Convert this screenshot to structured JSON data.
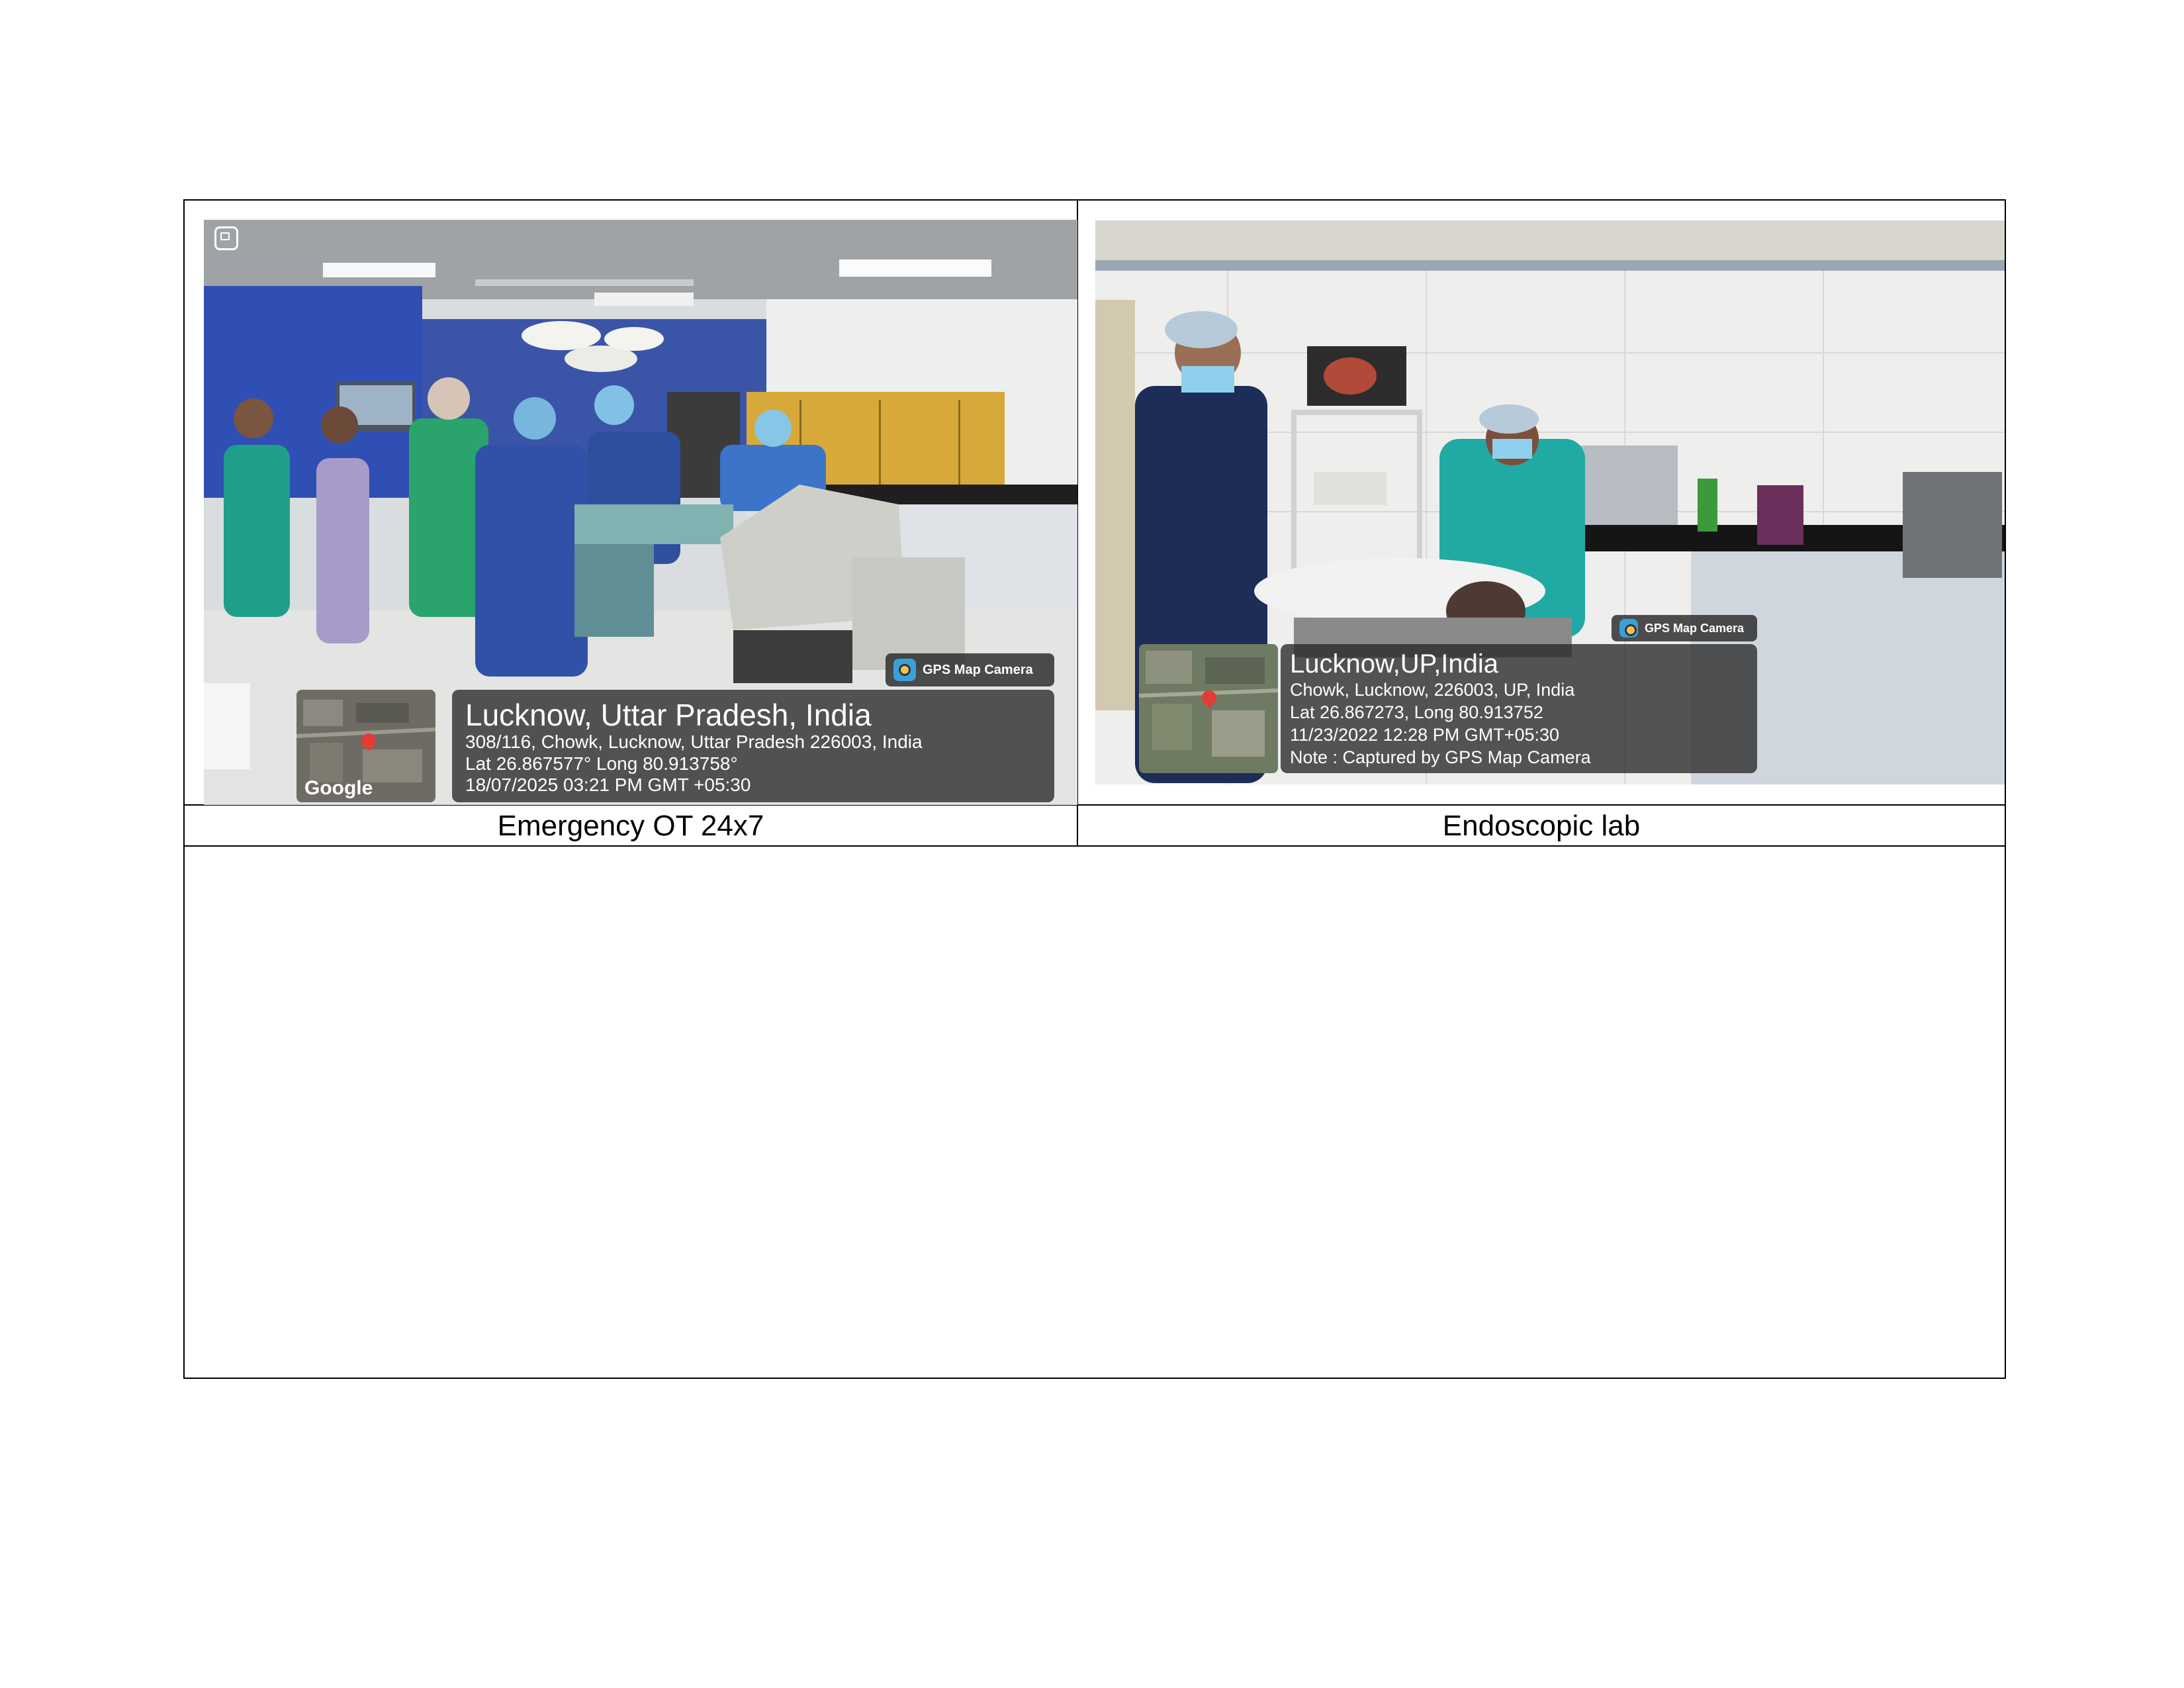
{
  "captions": {
    "left": "Emergency OT 24x7",
    "right": "Endoscopic lab"
  },
  "photo_left": {
    "badge": "GPS Map Camera",
    "title": "Lucknow, Uttar Pradesh, India",
    "address": "308/116, Chowk, Lucknow, Uttar Pradesh 226003, India",
    "coords": "Lat 26.867577° Long 80.913758°",
    "datetime": "18/07/2025 03:21 PM GMT +05:30",
    "map_label": "Google",
    "map_icon": "map-pin-icon",
    "corner_icon": "gallery-icon"
  },
  "photo_right": {
    "badge": "GPS Map Camera",
    "title": "Lucknow,UP,India",
    "address": "Chowk, Lucknow, 226003, UP, India",
    "coords": "Lat 26.867273, Long 80.913752",
    "datetime": "11/23/2022 12:28 PM GMT+05:30",
    "note": "Note : Captured by GPS Map Camera",
    "map_icon": "map-pin-icon"
  }
}
